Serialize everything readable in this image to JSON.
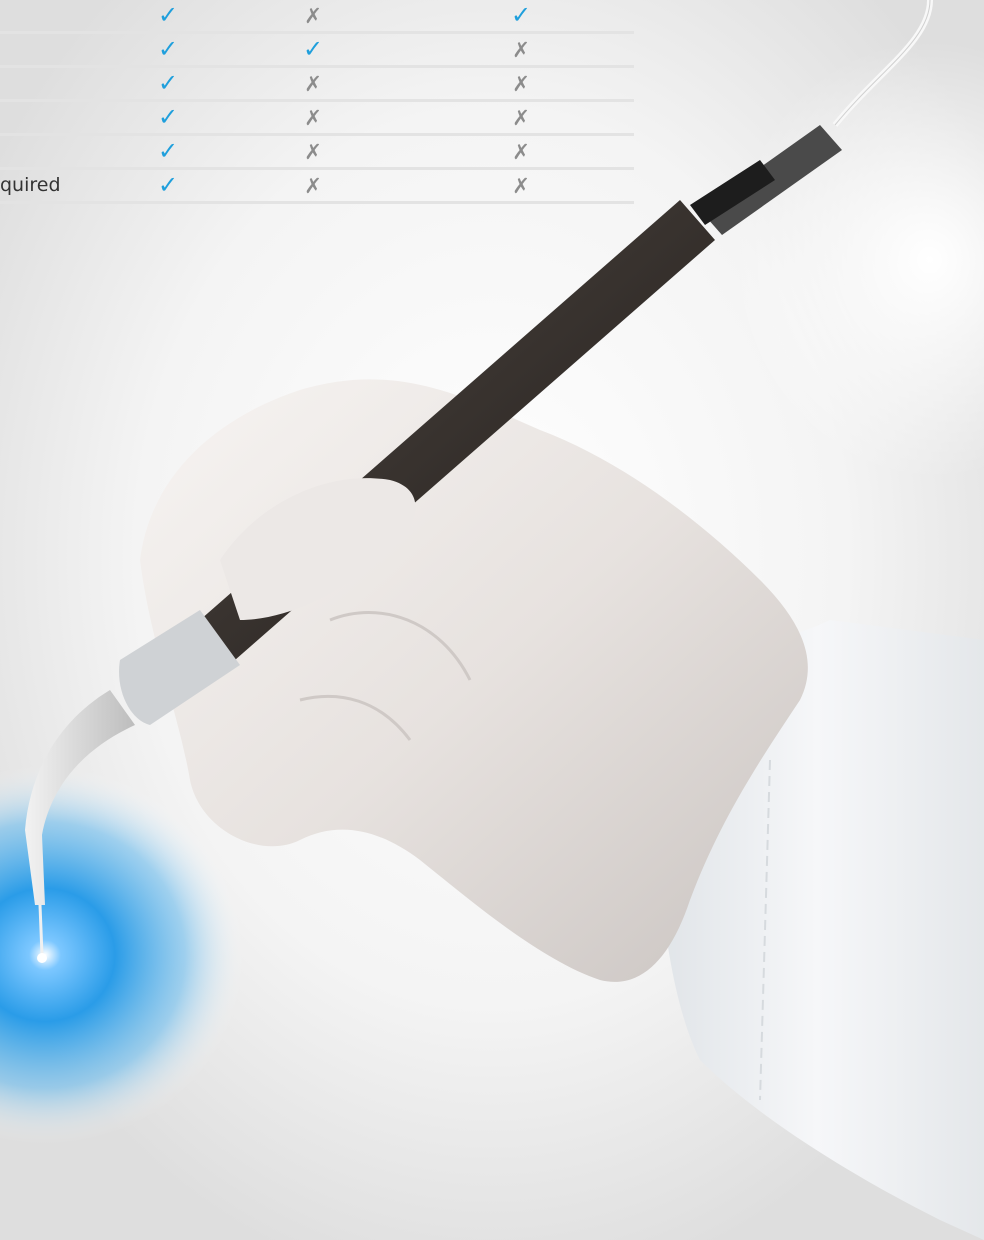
{
  "table": {
    "rows": [
      {
        "label": "",
        "marks": [
          "check",
          "cross",
          "check"
        ]
      },
      {
        "label": "",
        "marks": [
          "check",
          "check",
          "cross"
        ]
      },
      {
        "label": "",
        "marks": [
          "check",
          "cross",
          "cross"
        ]
      },
      {
        "label": "",
        "marks": [
          "check",
          "cross",
          "cross"
        ]
      },
      {
        "label": "",
        "marks": [
          "check",
          "cross",
          "cross"
        ]
      },
      {
        "label": "quired",
        "marks": [
          "check",
          "cross",
          "cross"
        ]
      }
    ],
    "symbols": {
      "check": "✓",
      "cross": "✗"
    },
    "colors": {
      "check": "#1f9fdc",
      "cross": "#8c8c8c",
      "divider": "#e3e3e3"
    }
  },
  "illustration": {
    "subject": "gloved hand holding a dental laser handpiece with glowing blue tip, white coat sleeve",
    "colors": {
      "glow": "#1a8fe0",
      "handle": "#3b3530",
      "glove": "#ece8e6",
      "sleeve": "#f2f4f6"
    }
  }
}
